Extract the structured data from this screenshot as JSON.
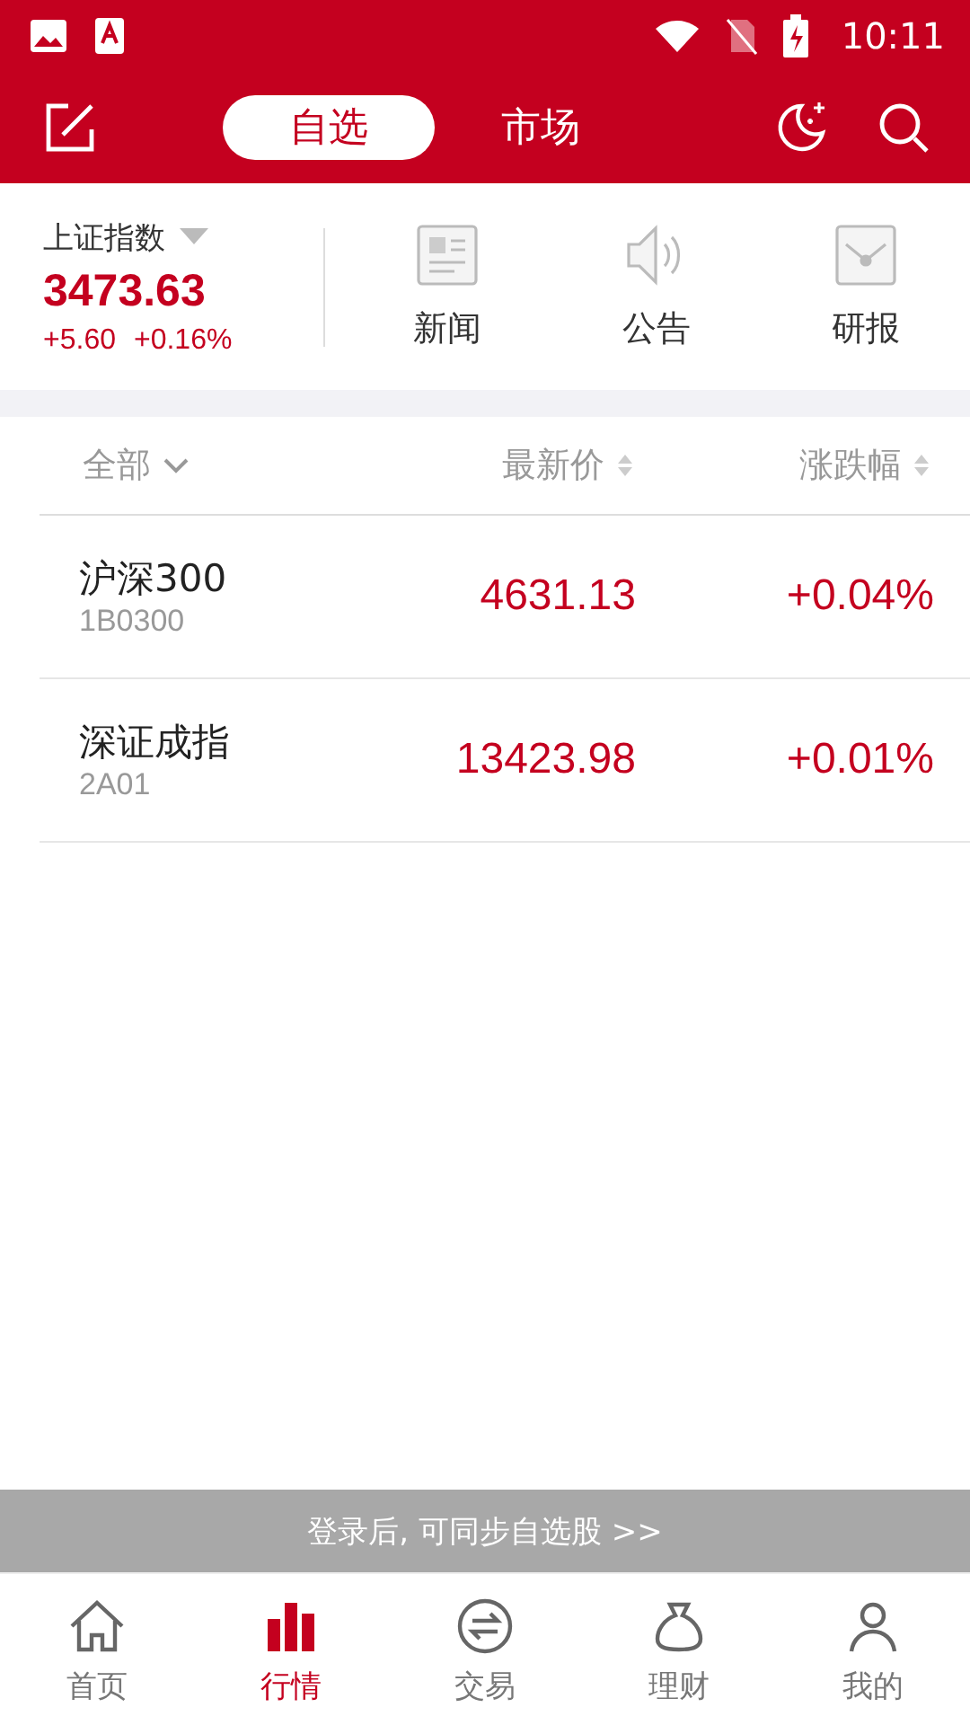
{
  "status_bar": {
    "time": "10:11"
  },
  "header": {
    "tabs": [
      {
        "label": "自选",
        "selected": true
      },
      {
        "label": "市场",
        "selected": false
      }
    ]
  },
  "index_panel": {
    "name": "上证指数",
    "value": "3473.63",
    "change": "+5.60",
    "change_pct": "+0.16%"
  },
  "shortcuts": [
    {
      "kind": "news",
      "label": "新闻"
    },
    {
      "kind": "notice",
      "label": "公告"
    },
    {
      "kind": "report",
      "label": "研报"
    }
  ],
  "table": {
    "columns": [
      {
        "label": "全部",
        "kind": "filter"
      },
      {
        "label": "最新价",
        "kind": "sort"
      },
      {
        "label": "涨跌幅",
        "kind": "sort"
      }
    ],
    "rows": [
      {
        "name": "沪深300",
        "code": "1B0300",
        "price": "4631.13",
        "change": "+0.04%"
      },
      {
        "name": "深证成指",
        "code": "2A01",
        "price": "13423.98",
        "change": "+0.01%"
      }
    ]
  },
  "login_banner": "登录后, 可同步自选股 >>",
  "bottom_nav": [
    {
      "kind": "home",
      "label": "首页",
      "selected": false
    },
    {
      "kind": "market",
      "label": "行情",
      "selected": true
    },
    {
      "kind": "trade",
      "label": "交易",
      "selected": false
    },
    {
      "kind": "wealth",
      "label": "理财",
      "selected": false
    },
    {
      "kind": "me",
      "label": "我的",
      "selected": false
    }
  ]
}
